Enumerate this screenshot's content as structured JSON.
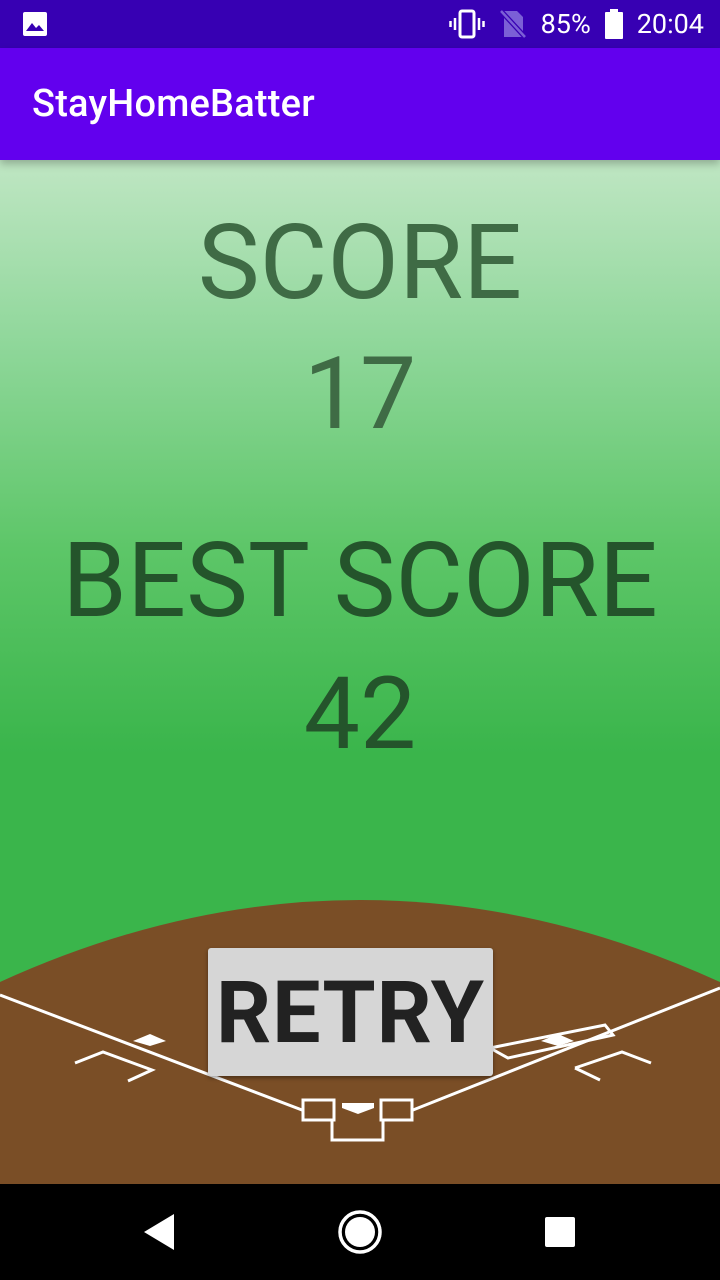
{
  "status_bar": {
    "notification_icon": "image-icon",
    "vibrate_icon": "vibrate-icon",
    "no_sim_icon": "no-sim-icon",
    "battery_percent": "85%",
    "battery_icon": "battery-icon",
    "time": "20:04"
  },
  "app_bar": {
    "title": "StayHomeBatter"
  },
  "game": {
    "score_label": "SCORE",
    "score_value": "17",
    "best_label": "BEST SCORE",
    "best_value": "42",
    "retry_label": "RETRY"
  },
  "nav_bar": {
    "back_icon": "back-icon",
    "home_icon": "home-icon",
    "recents_icon": "recents-icon"
  },
  "colors": {
    "status_bar": "#3700b3",
    "app_bar": "#6200ee",
    "field_dirt": "#7a4e26",
    "grass": "#3ab54b"
  }
}
